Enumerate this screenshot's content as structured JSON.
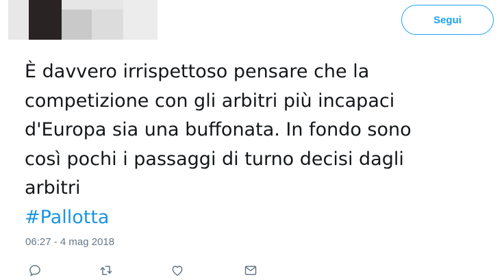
{
  "header": {
    "follow_label": "Segui"
  },
  "tweet": {
    "lines": [
      "È davvero irrispettoso pensare che la",
      "competizione con gli arbitri più incapaci",
      "d'Europa sia una buffonata. In fondo sono",
      "così pochi i passaggi di turno decisi dagli",
      "arbitri"
    ],
    "hashtag": "#Pallotta",
    "timestamp": "06:27 - 4 mag 2018"
  },
  "actions": {
    "icons": [
      "reply-icon",
      "retweet-icon",
      "like-icon",
      "direct-message-icon"
    ]
  },
  "colors": {
    "accent": "#1da1f2",
    "hashtag": "#1b95e0",
    "muted": "#657786",
    "text": "#14171a"
  }
}
